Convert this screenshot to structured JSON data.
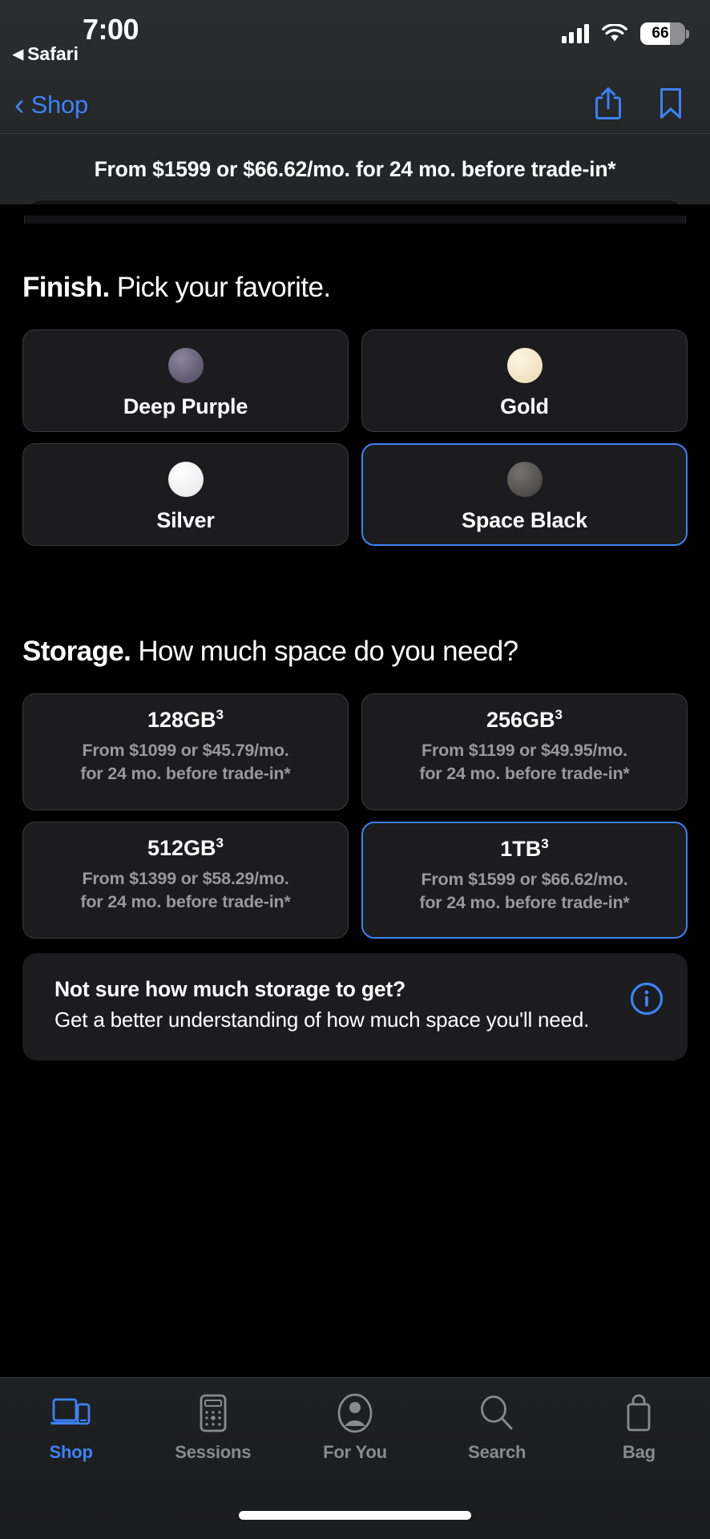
{
  "status_bar": {
    "time": "7:00",
    "return_app_label": "Safari",
    "return_arrow_icon": "left-triangle-icon",
    "cellular_icon": "cellular-bars-icon",
    "wifi_icon": "wifi-icon",
    "battery_icon": "battery-icon",
    "battery_percent": "66"
  },
  "nav_bar": {
    "back_label": "Shop",
    "back_icon": "chevron-left-icon",
    "share_icon": "share-icon",
    "bookmark_icon": "bookmark-icon"
  },
  "price_banner": {
    "text": "From $1599 or $66.62/mo. for 24 mo. before trade-in*"
  },
  "finish_section": {
    "heading_bold": "Finish.",
    "heading_rest": " Pick your favorite.",
    "options": [
      {
        "label": "Deep Purple",
        "swatch_color": "#6e6880",
        "selected": false
      },
      {
        "label": "Gold",
        "swatch_color": "#f2e8cf",
        "selected": false
      },
      {
        "label": "Silver",
        "swatch_color": "#f4f4f4",
        "selected": false
      },
      {
        "label": "Space Black",
        "swatch_color": "#5b5b59",
        "selected": true
      }
    ]
  },
  "storage_section": {
    "heading_bold": "Storage.",
    "heading_rest": " How much space do you need?",
    "options": [
      {
        "capacity": "128GB",
        "footnote": "3",
        "price_line1": "From $1099 or $45.79/mo.",
        "price_line2": "for 24 mo. before trade-in*",
        "selected": false
      },
      {
        "capacity": "256GB",
        "footnote": "3",
        "price_line1": "From $1199 or $49.95/mo.",
        "price_line2": "for 24 mo. before trade-in*",
        "selected": false
      },
      {
        "capacity": "512GB",
        "footnote": "3",
        "price_line1": "From $1399 or $58.29/mo.",
        "price_line2": "for 24 mo. before trade-in*",
        "selected": false
      },
      {
        "capacity": "1TB",
        "footnote": "3",
        "price_line1": "From $1599 or $66.62/mo.",
        "price_line2": "for 24 mo. before trade-in*",
        "selected": true
      }
    ]
  },
  "info_card": {
    "title": "Not sure how much storage to get?",
    "body": "Get a better understanding of how much space you'll need.",
    "icon": "info-circle-icon"
  },
  "tab_bar": {
    "items": [
      {
        "label": "Shop",
        "icon": "devices-icon",
        "active": true
      },
      {
        "label": "Sessions",
        "icon": "calculator-icon",
        "active": false
      },
      {
        "label": "For You",
        "icon": "person-circle-icon",
        "active": false
      },
      {
        "label": "Search",
        "icon": "magnifier-icon",
        "active": false
      },
      {
        "label": "Bag",
        "icon": "shopping-bag-icon",
        "active": false
      }
    ]
  },
  "colors": {
    "accent_blue": "#3b82f6",
    "card_bg": "#1c1c1e",
    "card_border": "#3a3a3c",
    "muted_text": "#98989d",
    "page_bg": "#000000"
  }
}
